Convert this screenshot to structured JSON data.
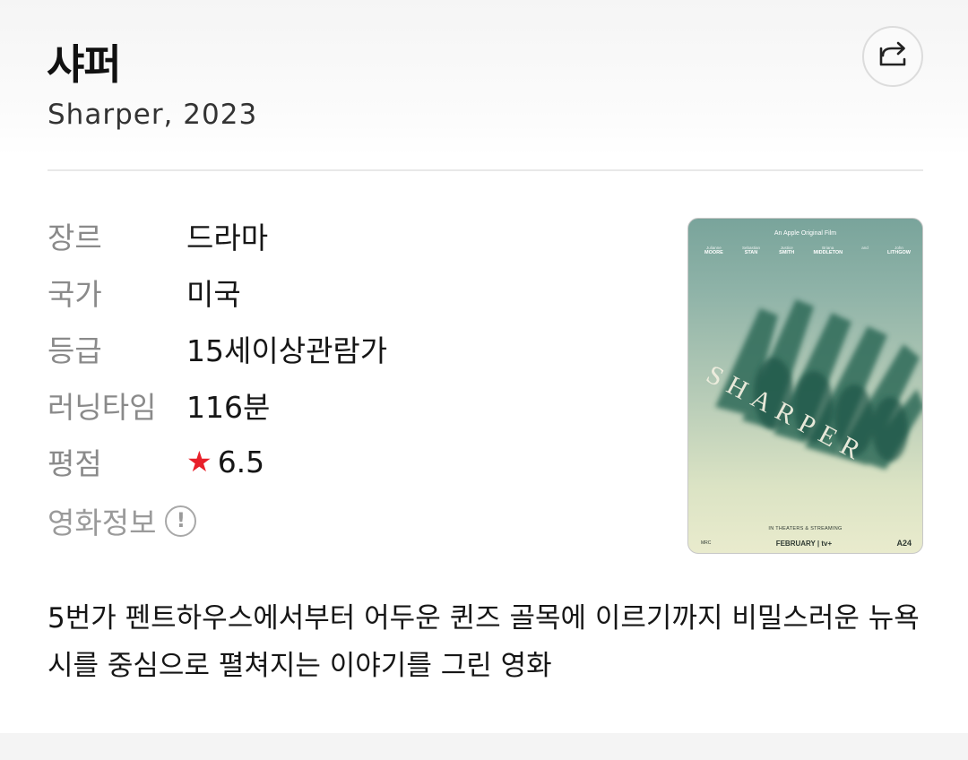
{
  "movie": {
    "title": "샤퍼",
    "subtitle": "Sharper, 2023"
  },
  "share": {
    "icon": "share-icon"
  },
  "info": [
    {
      "label": "장르",
      "value": "드라마"
    },
    {
      "label": "국가",
      "value": "미국"
    },
    {
      "label": "등급",
      "value": "15세이상관람가"
    },
    {
      "label": "러닝타임",
      "value": "116분"
    },
    {
      "label": "평점",
      "value": "6.5",
      "icon": "star-icon"
    }
  ],
  "more": {
    "label": "영화정보",
    "icon": "info-icon",
    "icon_glyph": "!"
  },
  "poster": {
    "top_text": "An Apple Original Film",
    "cast": [
      {
        "first": "Julianne",
        "last": "MOORE"
      },
      {
        "first": "Sebastian",
        "last": "STAN"
      },
      {
        "first": "Justice",
        "last": "SMITH"
      },
      {
        "first": "Briana",
        "last": "MIDDLETON"
      },
      {
        "first": "John",
        "last": "LITHGOW"
      }
    ],
    "cast_and": "and",
    "title_art": "SHARPER",
    "bottom_text": "IN THEATERS & STREAMING",
    "release": "FEBRUARY | tv+",
    "studio": "A24",
    "left_logo": "MRC"
  },
  "description": "5번가 펜트하우스에서부터 어두운 퀸즈 골목에 이르기까지 비밀스러운 뉴욕시를 중심으로 펼쳐지는 이야기를 그린 영화",
  "colors": {
    "star": "#e8202a",
    "label": "#8a8a8a",
    "text": "#161616"
  }
}
